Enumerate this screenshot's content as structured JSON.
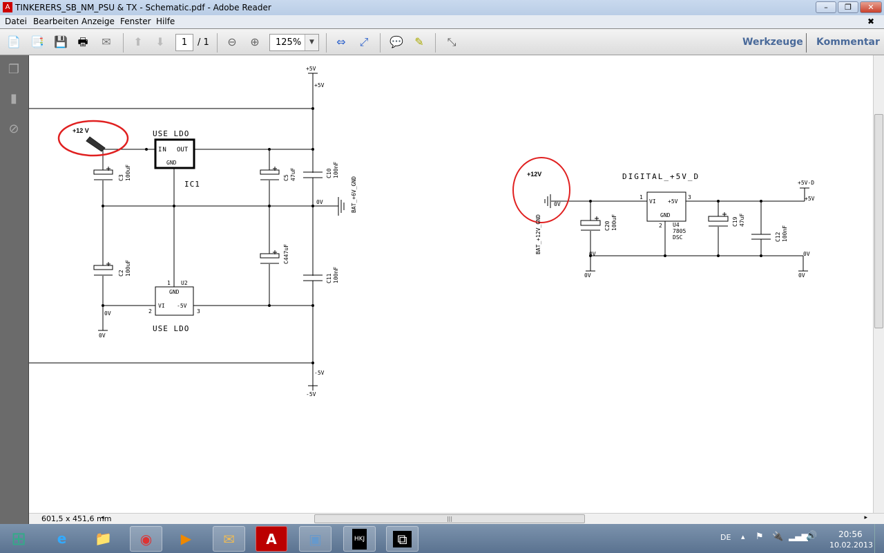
{
  "window": {
    "title": "TINKERERS_SB_NM_PSU & TX - Schematic.pdf - Adobe Reader",
    "minimize": "minimize",
    "restore": "restore",
    "close": "close"
  },
  "menu": [
    "Datei",
    "Bearbeiten",
    "Anzeige",
    "Fenster",
    "Hilfe"
  ],
  "toolbar": {
    "page_current": "1",
    "page_total": "/ 1",
    "zoom": "125%",
    "tools_label": "Werkzeuge",
    "comment_label": "Kommentar"
  },
  "status": {
    "dimensions": "601,5 x 451,6 mm"
  },
  "schematic": {
    "left": {
      "top_rail_label": "+5V",
      "top_rail_net": "+5V",
      "bottom_rail_net": "-5V",
      "bottom_rail_label": "-5V",
      "input_annotation": "+12 V",
      "ic1_note": "USE LDO",
      "ic1_in": "IN",
      "ic1_out": "OUT",
      "ic1_gnd": "GND",
      "ic1_ref": "IC1",
      "c3": "C3",
      "c3_val": "100uF",
      "c2": "C2",
      "c2_val": "100uF",
      "c5": "C5",
      "c5_val": "47uF",
      "c4": "C447uF",
      "c10": "C10",
      "c10_val": "100nF",
      "c11": "C11",
      "c11_val": "100nF",
      "gnd_net": "0V",
      "gnd_port": "BAT_+6V_GND",
      "u2_pin1": "1",
      "u2_ref": "U2",
      "u2_gnd": "GND",
      "u2_vi": "VI",
      "u2_out": "-5V",
      "u2_pin2": "2",
      "u2_pin3": "3",
      "u2_note": "USE LDO",
      "bottom_net": "0V",
      "bottom_label": "0V"
    },
    "right": {
      "input_annotation": "+12V",
      "gnd_port": "BAT_+12V_GND",
      "in_net": "0V",
      "title": "DIGITAL_+5V_D",
      "u4_pin1": "1",
      "u4_pin3": "3",
      "u4_pin2": "2",
      "u4_vi": "VI",
      "u4_out": "+5V",
      "u4_gnd": "GND",
      "u4_ref": "U4",
      "u4_part": "7805",
      "u4_pkg": "DSC",
      "c20": "C20",
      "c20_val": "100uF",
      "c19": "C19",
      "c19_val": "47uF",
      "c12": "C12",
      "c12_val": "100nF",
      "out_label": "+5V-D",
      "out_net": "+5V",
      "gnd_net_left": "0V",
      "gnd_net_right": "0V",
      "gnd_label_left": "0V",
      "gnd_label_right": "0V"
    },
    "annotation_color": "#e02020"
  },
  "taskbar": {
    "apps": [
      "start",
      "internet-explorer",
      "explorer",
      "chrome",
      "media-player",
      "mail",
      "adobe-reader",
      "photo-viewer",
      "hkjee",
      "app-logo"
    ],
    "lang": "DE",
    "time": "20:56",
    "date": "10.02.2013"
  }
}
